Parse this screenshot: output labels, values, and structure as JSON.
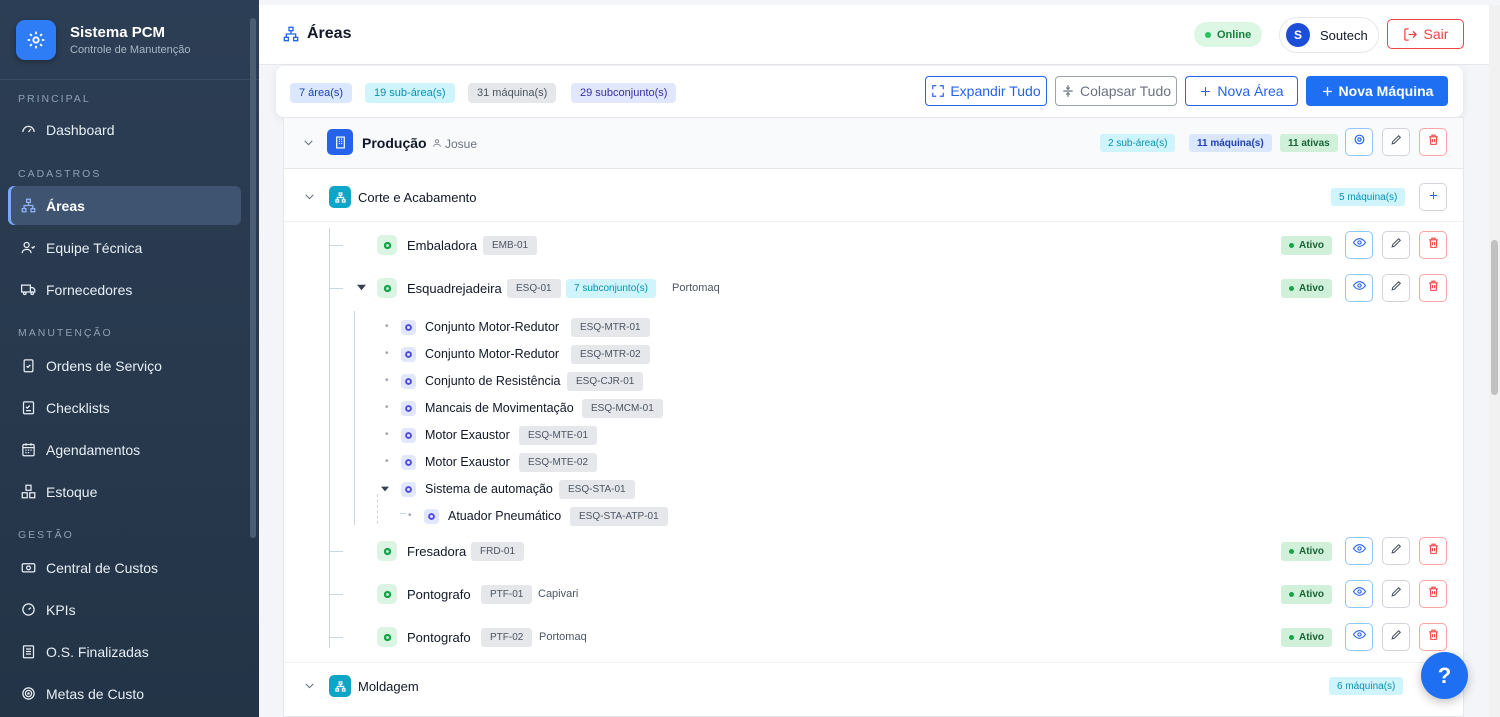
{
  "brand": {
    "title": "Sistema PCM",
    "subtitle": "Controle de Manutenção",
    "icon": "gear-icon"
  },
  "sidebar": {
    "sections": [
      {
        "label": "PRINCIPAL",
        "items": [
          {
            "label": "Dashboard",
            "icon": "dashboard-icon"
          }
        ]
      },
      {
        "label": "CADASTROS",
        "items": [
          {
            "label": "Áreas",
            "icon": "sitemap-icon",
            "active": true
          },
          {
            "label": "Equipe Técnica",
            "icon": "users-icon"
          },
          {
            "label": "Fornecedores",
            "icon": "truck-icon"
          }
        ]
      },
      {
        "label": "MANUTENÇÃO",
        "items": [
          {
            "label": "Ordens de Serviço",
            "icon": "clipboard-icon"
          },
          {
            "label": "Checklists",
            "icon": "checklist-icon"
          },
          {
            "label": "Agendamentos",
            "icon": "calendar-icon"
          },
          {
            "label": "Estoque",
            "icon": "boxes-icon"
          }
        ]
      },
      {
        "label": "GESTÃO",
        "items": [
          {
            "label": "Central de Custos",
            "icon": "money-icon"
          },
          {
            "label": "KPIs",
            "icon": "gauge-icon"
          },
          {
            "label": "O.S. Finalizadas",
            "icon": "archive-icon"
          },
          {
            "label": "Metas de Custo",
            "icon": "target-icon"
          }
        ]
      }
    ]
  },
  "header": {
    "title": "Áreas",
    "status": "Online",
    "user_initial": "S",
    "user_name": "Soutech",
    "logout_label": "Sair"
  },
  "toolbar": {
    "counts": [
      "7 área(s)",
      "19 sub-área(s)",
      "31 máquina(s)",
      "29 subconjunto(s)"
    ],
    "expand_label": "Expandir Tudo",
    "collapse_label": "Colapsar Tudo",
    "new_area_label": "Nova Área",
    "new_machine_label": "Nova Máquina"
  },
  "area": {
    "name": "Produção",
    "responsible": "Josue",
    "sub_areas": "2 sub-área(s)",
    "machines": "11 máquina(s)",
    "active": "11 ativas"
  },
  "subarea1": {
    "name": "Corte e Acabamento",
    "machines": "5 máquina(s)"
  },
  "machines": [
    {
      "name": "Embaladora",
      "code": "EMB-01",
      "supplier": "",
      "status": "Ativo"
    },
    {
      "name": "Esquadrejadeira",
      "code": "ESQ-01",
      "subsets": "7 subconjunto(s)",
      "supplier": "Portomaq",
      "status": "Ativo"
    },
    {
      "name": "Fresadora",
      "code": "FRD-01",
      "supplier": "",
      "status": "Ativo"
    },
    {
      "name": "Pontografo",
      "code": "PTF-01",
      "supplier": "Capivari",
      "status": "Ativo"
    },
    {
      "name": "Pontografo",
      "code": "PTF-02",
      "supplier": "Portomaq",
      "status": "Ativo"
    }
  ],
  "subsets": [
    {
      "name": "Conjunto Motor-Redutor",
      "code": "ESQ-MTR-01"
    },
    {
      "name": "Conjunto Motor-Redutor",
      "code": "ESQ-MTR-02"
    },
    {
      "name": "Conjunto de Resistência",
      "code": "ESQ-CJR-01"
    },
    {
      "name": "Mancais de Movimentação",
      "code": "ESQ-MCM-01"
    },
    {
      "name": "Motor Exaustor",
      "code": "ESQ-MTE-01"
    },
    {
      "name": "Motor Exaustor",
      "code": "ESQ-MTE-02"
    },
    {
      "name": "Sistema de automação",
      "code": "ESQ-STA-01"
    },
    {
      "name": "Atuador Pneumático",
      "code": "ESQ-STA-ATP-01"
    }
  ],
  "subarea2": {
    "name": "Moldagem",
    "machines": "6 máquina(s)"
  },
  "help_label": "?",
  "colors": {
    "primary": "#1f6ff2",
    "sidebar": "#2c3e55",
    "success": "#16a34a",
    "danger": "#ef4444",
    "cyan": "#0ea5c6"
  }
}
